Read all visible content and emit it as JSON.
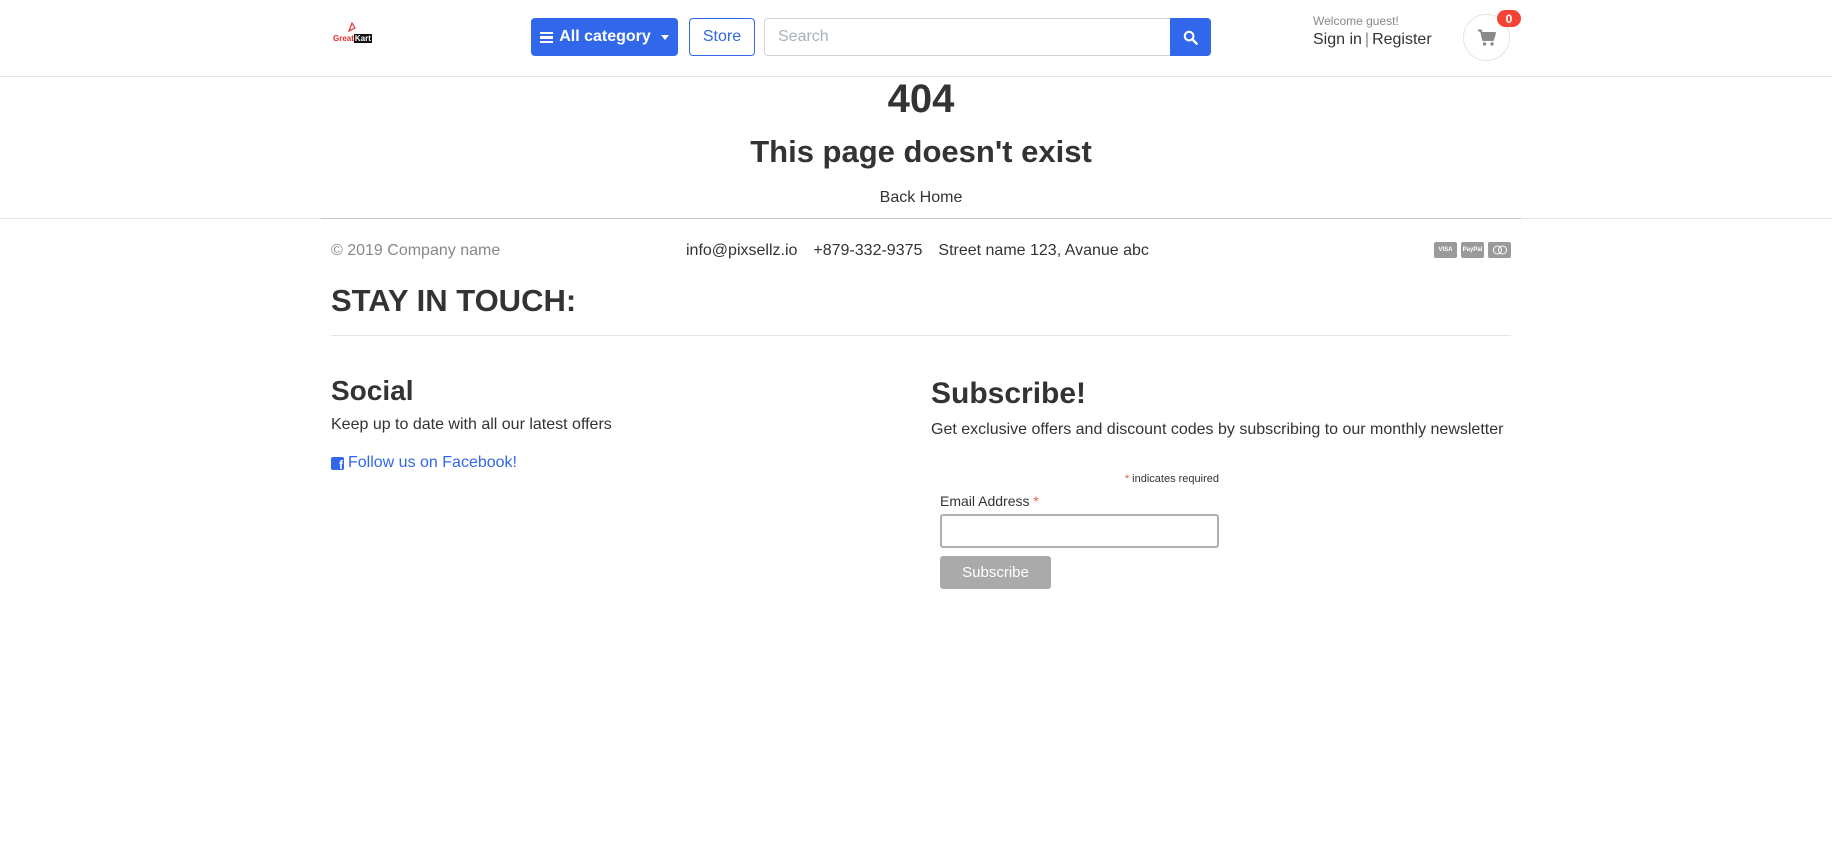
{
  "header": {
    "logo": {
      "text_red": "Great",
      "text_dark": "Kart"
    },
    "category_button": "All category",
    "store_button": "Store",
    "search": {
      "placeholder": "Search",
      "value": ""
    },
    "welcome_text": "Welcome guest!",
    "sign_in": "Sign in",
    "separator": "|",
    "register": "Register",
    "cart_count": "0"
  },
  "error": {
    "code": "404",
    "message": "This page doesn't exist",
    "back_home": "Back Home"
  },
  "footer": {
    "copyright": "© 2019 Company name",
    "email": "info@pixsellz.io",
    "phone": "+879-332-9375",
    "address": "Street name 123, Avanue abc",
    "payment_icons": [
      "visa-icon",
      "paypal-icon",
      "mastercard-icon"
    ],
    "payment_labels": [
      "VISA",
      "PayPal",
      "MC"
    ]
  },
  "stay_in_touch": {
    "heading": "STAY IN TOUCH:",
    "social": {
      "heading": "Social",
      "text": "Keep up to date with all our latest offers",
      "facebook_link": "Follow us on Facebook!"
    },
    "subscribe": {
      "heading": "Subscribe!",
      "text": "Get exclusive offers and discount codes by subscribing to our monthly newsletter",
      "required_asterisk": "*",
      "required_note": " indicates required",
      "email_label": "Email Address ",
      "email_asterisk": "*",
      "email_value": "",
      "button": "Subscribe"
    }
  },
  "colors": {
    "primary": "#3167eb",
    "badge": "#f44336",
    "required": "#e85c41",
    "subscribe_button": "#aaaaaa"
  }
}
